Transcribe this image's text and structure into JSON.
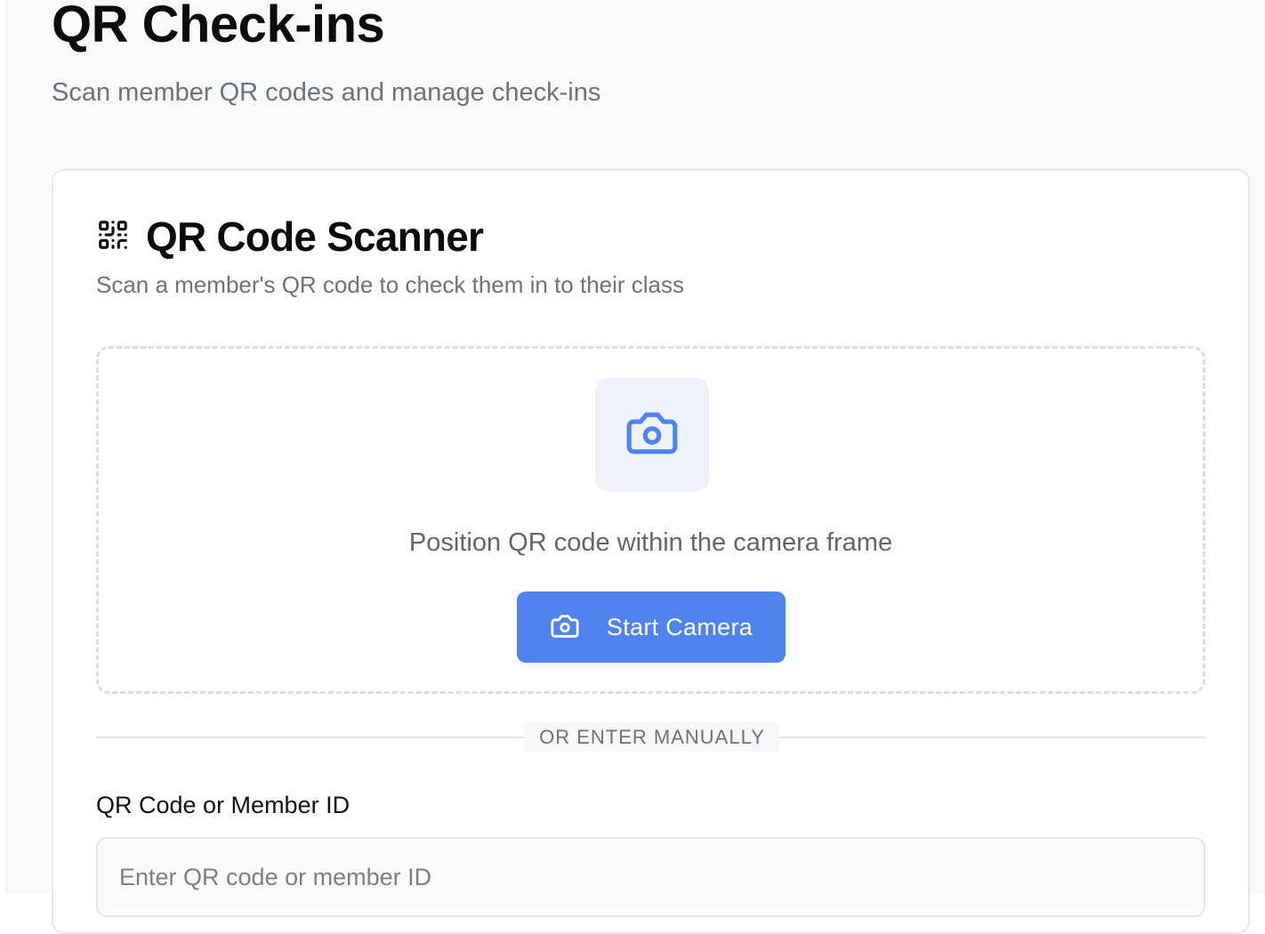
{
  "page": {
    "title": "QR Check-ins",
    "subtitle": "Scan member QR codes and manage check-ins"
  },
  "scanner": {
    "title": "QR Code Scanner",
    "description": "Scan a member's QR code to check them in to their class",
    "title_icon": "qr-code-icon",
    "camera_icon": "camera-icon",
    "instruction": "Position QR code within the camera frame",
    "start_button_label": "Start Camera",
    "divider_text": "OR ENTER MANUALLY"
  },
  "manual_entry": {
    "label": "QR Code or Member ID",
    "placeholder": "Enter QR code or member ID",
    "value": ""
  },
  "colors": {
    "accent": "#4f84ee",
    "camera_tile_bg": "#eef2fb",
    "muted_text": "#6b7280"
  }
}
